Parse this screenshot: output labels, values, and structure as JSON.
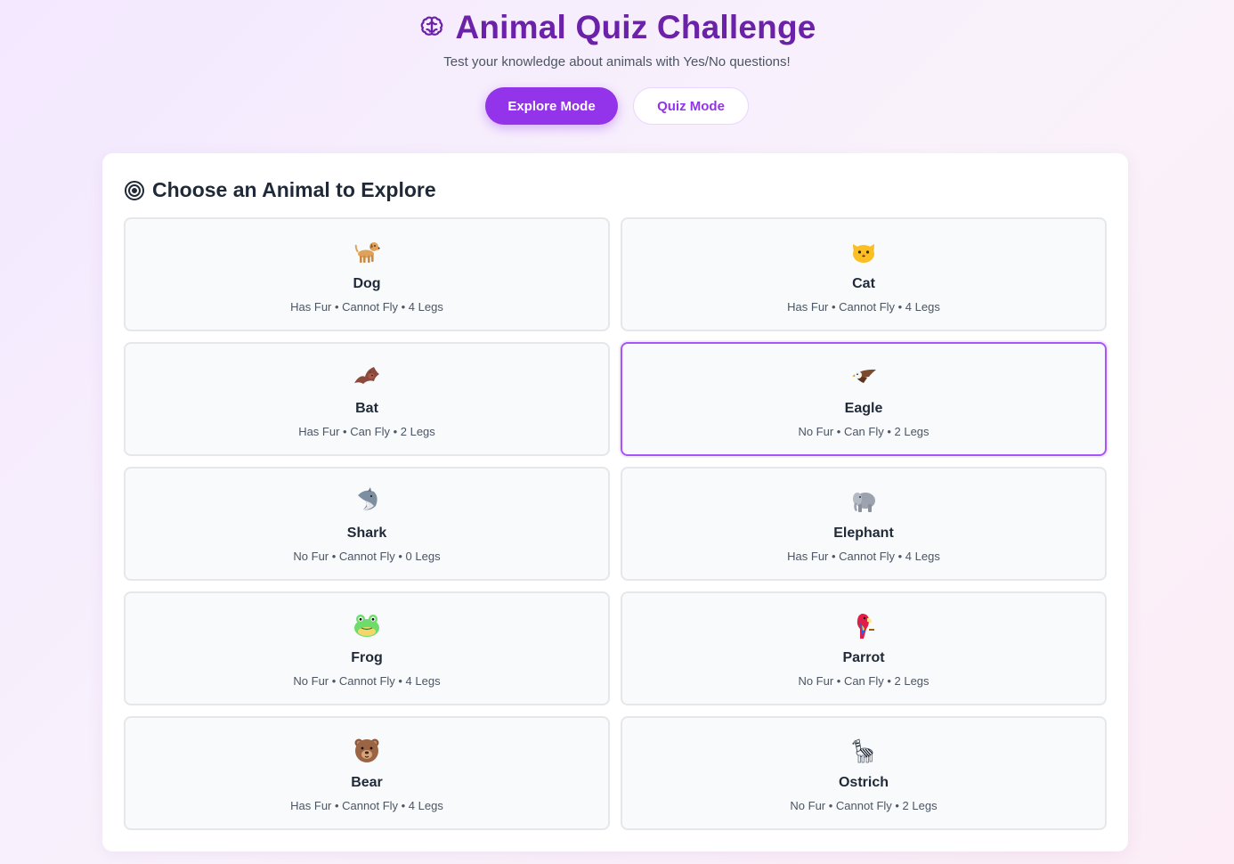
{
  "header": {
    "title": "Animal Quiz Challenge",
    "subtitle": "Test your knowledge about animals with Yes/No questions!",
    "title_icon": "brain-icon",
    "modes": [
      {
        "label": "Explore Mode",
        "active": true
      },
      {
        "label": "Quiz Mode",
        "active": false
      }
    ]
  },
  "explore": {
    "title": "Choose an Animal to Explore",
    "title_icon": "target-icon",
    "selected_index": 3,
    "animals": [
      {
        "name": "Dog",
        "icon": "dog-icon",
        "traits": "Has Fur • Cannot Fly • 4 Legs"
      },
      {
        "name": "Cat",
        "icon": "cat-icon",
        "traits": "Has Fur • Cannot Fly • 4 Legs"
      },
      {
        "name": "Bat",
        "icon": "bat-icon",
        "traits": "Has Fur • Can Fly • 2 Legs"
      },
      {
        "name": "Eagle",
        "icon": "eagle-icon",
        "traits": "No Fur • Can Fly • 2 Legs"
      },
      {
        "name": "Shark",
        "icon": "shark-icon",
        "traits": "No Fur • Cannot Fly • 0 Legs"
      },
      {
        "name": "Elephant",
        "icon": "elephant-icon",
        "traits": "Has Fur • Cannot Fly • 4 Legs"
      },
      {
        "name": "Frog",
        "icon": "frog-icon",
        "traits": "No Fur • Cannot Fly • 4 Legs"
      },
      {
        "name": "Parrot",
        "icon": "parrot-icon",
        "traits": "No Fur • Can Fly • 2 Legs"
      },
      {
        "name": "Bear",
        "icon": "bear-icon",
        "traits": "Has Fur • Cannot Fly • 4 Legs"
      },
      {
        "name": "Ostrich",
        "icon": "zebra-icon",
        "traits": "No Fur • Cannot Fly • 2 Legs"
      }
    ]
  },
  "colors": {
    "accent": "#9333ea",
    "title": "#6b21a8",
    "selected_border": "#a855f7"
  }
}
